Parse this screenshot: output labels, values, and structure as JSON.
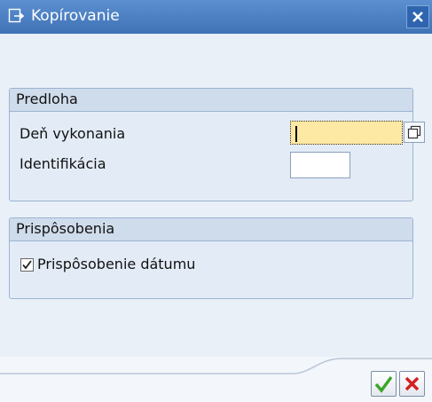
{
  "window": {
    "title": "Kopírovanie"
  },
  "groups": {
    "predloha": {
      "title": "Predloha",
      "fields": [
        {
          "label": "Deň vykonania",
          "value": ""
        },
        {
          "label": "Identifikácia",
          "value": ""
        }
      ]
    },
    "prisposobenia": {
      "title": "Prispôsobenia",
      "checkbox_label": "Prispôsobenie dátumu",
      "checkbox_checked": true
    }
  },
  "icons": {
    "title": "copy-icon",
    "close": "close-icon",
    "value_help": "value-help-icon",
    "confirm": "checkmark-icon",
    "cancel": "cancel-icon"
  },
  "colors": {
    "title_bar": "#4a7fc3",
    "focused_field": "#fde8a4",
    "confirm": "#3aa52a",
    "cancel": "#d42020"
  }
}
